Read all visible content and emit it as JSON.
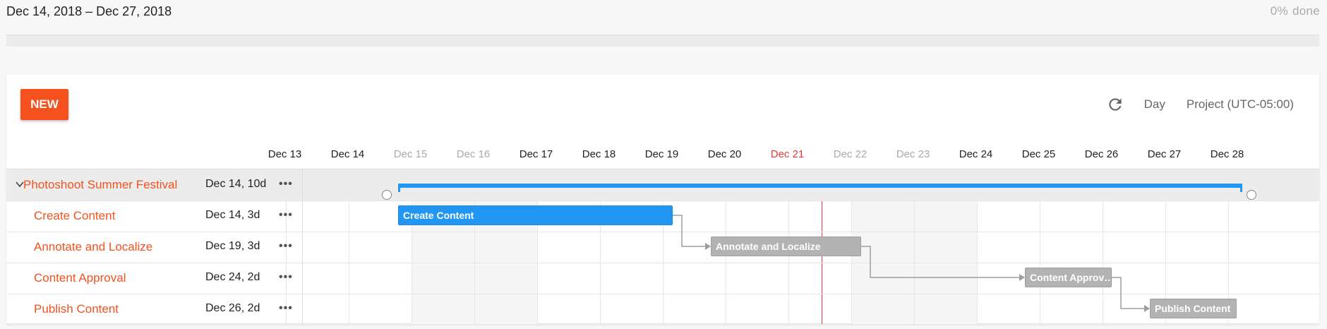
{
  "header": {
    "date_range": "Dec 14, 2018 – Dec 27, 2018",
    "progress_percent": "0%",
    "progress_label": "done",
    "progress_value": 0
  },
  "toolbar": {
    "new_label": "NEW",
    "refresh_icon": "refresh-icon",
    "scale_label": "Day",
    "timezone_label": "Project (UTC-05:00)"
  },
  "timeline": {
    "dates": [
      {
        "label": "Dec 13",
        "kind": "normal"
      },
      {
        "label": "Dec 14",
        "kind": "normal"
      },
      {
        "label": "Dec 15",
        "kind": "weekend"
      },
      {
        "label": "Dec 16",
        "kind": "weekend"
      },
      {
        "label": "Dec 17",
        "kind": "normal"
      },
      {
        "label": "Dec 18",
        "kind": "normal"
      },
      {
        "label": "Dec 19",
        "kind": "normal"
      },
      {
        "label": "Dec 20",
        "kind": "normal"
      },
      {
        "label": "Dec 21",
        "kind": "today"
      },
      {
        "label": "Dec 22",
        "kind": "weekend"
      },
      {
        "label": "Dec 23",
        "kind": "weekend"
      },
      {
        "label": "Dec 24",
        "kind": "normal"
      },
      {
        "label": "Dec 25",
        "kind": "normal"
      },
      {
        "label": "Dec 26",
        "kind": "normal"
      },
      {
        "label": "Dec 27",
        "kind": "normal"
      },
      {
        "label": "Dec 28",
        "kind": "normal"
      }
    ]
  },
  "project": {
    "name": "Photoshoot Summer Festival",
    "meta": "Dec 14, 10d",
    "more": "•••"
  },
  "tasks": [
    {
      "name": "Create Content",
      "meta": "Dec 14, 3d",
      "more": "•••",
      "bar_label": "Create Content",
      "style": "blue"
    },
    {
      "name": "Annotate and Localize",
      "meta": "Dec 19, 3d",
      "more": "•••",
      "bar_label": "Annotate and Localize",
      "style": "gray"
    },
    {
      "name": "Content Approval",
      "meta": "Dec 24, 2d",
      "more": "•••",
      "bar_label": "Content Approv…",
      "style": "gray"
    },
    {
      "name": "Publish Content",
      "meta": "Dec 26, 2d",
      "more": "•••",
      "bar_label": "Publish Content",
      "style": "gray"
    }
  ],
  "colors": {
    "accent": "#f4511e",
    "bar_blue": "#2196f3",
    "bar_gray": "#b3b3b3",
    "today": "#e53935"
  }
}
